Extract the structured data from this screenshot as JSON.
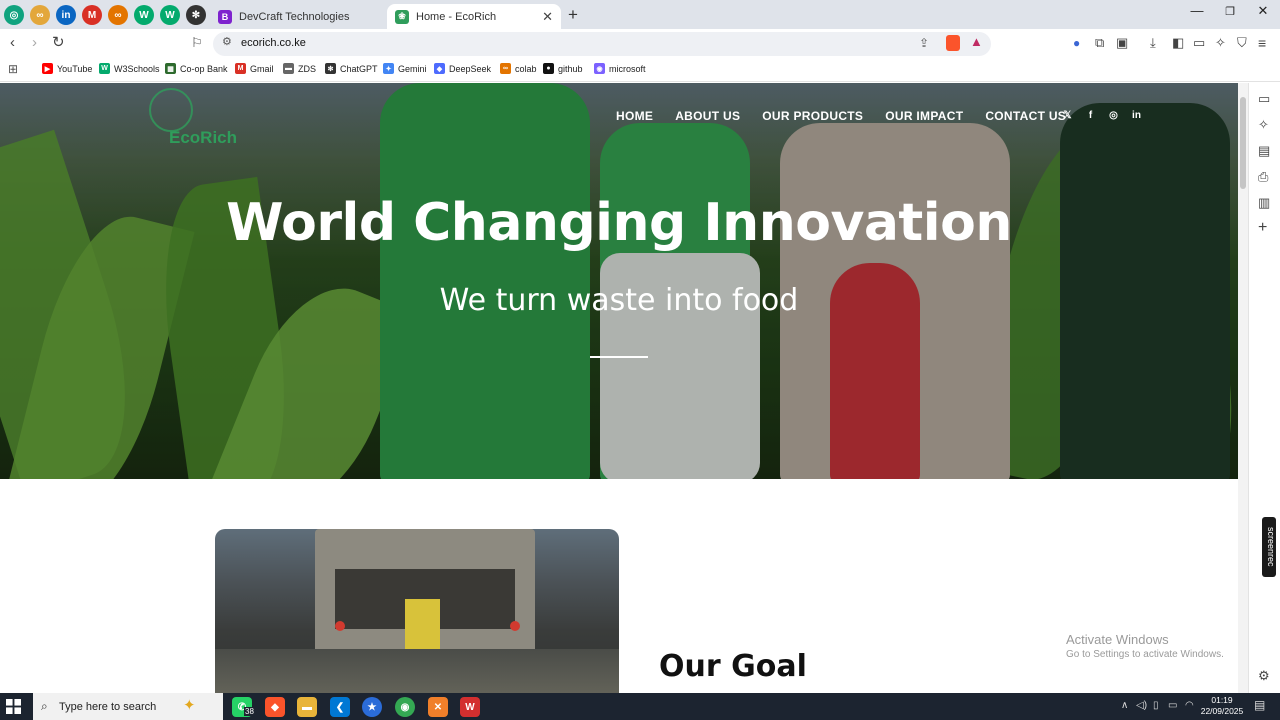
{
  "browser": {
    "pinned_tabs": [
      {
        "icon": "chatgpt-icon",
        "color": "#10a37f",
        "glyph": "◎"
      },
      {
        "icon": "colab-icon",
        "color": "#e3a73b",
        "glyph": "∞"
      },
      {
        "icon": "linkedin-icon",
        "color": "#0a66c2",
        "glyph": "in"
      },
      {
        "icon": "gmail-icon",
        "color": "#d93025",
        "glyph": "M"
      },
      {
        "icon": "colab-icon",
        "color": "#e37400",
        "glyph": "∞"
      },
      {
        "icon": "w3-icon",
        "color": "#04aa6d",
        "glyph": "W"
      },
      {
        "icon": "w3-icon",
        "color": "#04aa6d",
        "glyph": "W"
      },
      {
        "icon": "openai-icon",
        "color": "#333333",
        "glyph": "✻"
      }
    ],
    "tabs": [
      {
        "title": "DevCraft Technologies",
        "favicon": "B",
        "color": "#7e22ce"
      },
      {
        "title": "Home - EcoRich",
        "favicon": "❀",
        "color": "#2f9d5b"
      }
    ],
    "url": "ecorich.co.ke",
    "bookmarks": [
      {
        "label": "YouTube",
        "icon": "youtube-icon",
        "color": "#ff0000",
        "glyph": "▶"
      },
      {
        "label": "W3Schools",
        "icon": "w3-icon",
        "color": "#04aa6d",
        "glyph": "W"
      },
      {
        "label": "Co-op Bank",
        "icon": "bank-icon",
        "color": "#2d6a2d",
        "glyph": "▦"
      },
      {
        "label": "Gmail",
        "icon": "gmail-icon",
        "color": "#d93025",
        "glyph": "M"
      },
      {
        "label": "ZDS",
        "icon": "zds-icon",
        "color": "#666666",
        "glyph": "▬"
      },
      {
        "label": "ChatGPT",
        "icon": "chatgpt-icon",
        "color": "#333333",
        "glyph": "✻"
      },
      {
        "label": "Gemini",
        "icon": "gemini-icon",
        "color": "#4285f4",
        "glyph": "✦"
      },
      {
        "label": "DeepSeek",
        "icon": "deepseek-icon",
        "color": "#4d6bfe",
        "glyph": "◆"
      },
      {
        "label": "colab",
        "icon": "colab-icon",
        "color": "#e37400",
        "glyph": "∞"
      },
      {
        "label": "github",
        "icon": "github-icon",
        "color": "#111111",
        "glyph": "●"
      },
      {
        "label": "microsoft",
        "icon": "microsoft-icon",
        "color": "#7b61ff",
        "glyph": "◉"
      }
    ]
  },
  "site": {
    "logo_text": "EcoRich",
    "nav": [
      "HOME",
      "ABOUT US",
      "OUR PRODUCTS",
      "OUR IMPACT",
      "CONTACT US"
    ],
    "social": [
      {
        "icon": "x-icon",
        "glyph": "𝕏"
      },
      {
        "icon": "facebook-icon",
        "glyph": "f"
      },
      {
        "icon": "instagram-icon",
        "glyph": "◎"
      },
      {
        "icon": "linkedin-icon",
        "glyph": "in"
      }
    ],
    "hero_title": "World Changing Innovation",
    "hero_subtitle": "We turn waste into food",
    "goal_heading": "Our Goal",
    "accent": "#2f9d5b"
  },
  "system": {
    "watermark_title": "Activate Windows",
    "watermark_sub": "Go to Settings to activate Windows.",
    "screenrec": "screenrec",
    "search_placeholder": "Type here to search",
    "whatsapp_badge": "38",
    "time": "01:19",
    "date": "22/09/2025"
  }
}
